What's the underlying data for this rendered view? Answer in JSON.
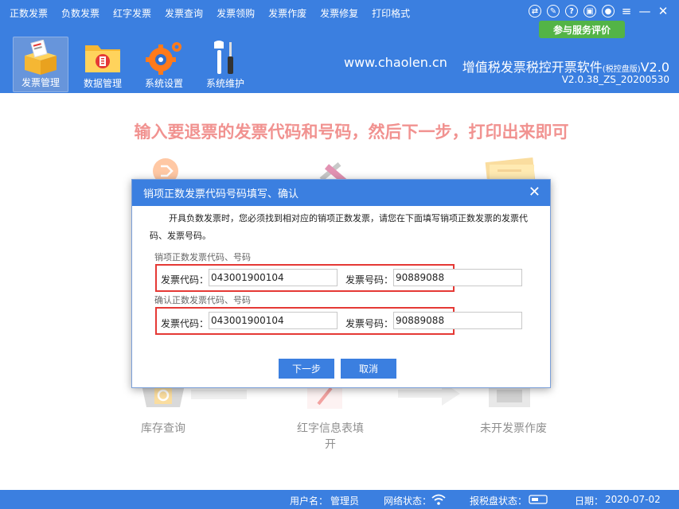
{
  "header": {
    "menu": [
      "正数发票",
      "负数发票",
      "红字发票",
      "发票查询",
      "发票领购",
      "发票作废",
      "发票修复",
      "打印格式"
    ],
    "feedback_button": "参与服务评价",
    "toolbar": {
      "invoice_mgmt": "发票管理",
      "data_mgmt": "数据管理",
      "system_settings": "系统设置",
      "system_maintenance": "系统维护"
    },
    "site_url": "www.chaolen.cn",
    "product_name": "增值税发票税控开票软件",
    "product_edition": "(税控盘版)",
    "product_version_short": "V2.0",
    "product_version": "V2.0.38_ZS_20200530"
  },
  "main": {
    "instruction": "输入要退票的发票代码和号码，然后下一步，打印出来即可",
    "bg_labels": {
      "inventory_query": "库存查询",
      "red_info_form_line1": "红字信息表填",
      "red_info_form_line2": "开",
      "unissued_void": "未开发票作废"
    }
  },
  "dialog": {
    "title": "销项正数发票代码号码填写、确认",
    "description": "开具负数发票时，您必须找到相对应的销项正数发票，请您在下面填写销项正数发票的发票代码、发票号码。",
    "section1_label": "销项正数发票代码、号码",
    "section2_label": "确认正数发票代码、号码",
    "code_label": "发票代码：",
    "number_label": "发票号码：",
    "code_value": "043001900104",
    "number_value": "90889088",
    "confirm_code_value": "043001900104",
    "confirm_number_value": "90889088",
    "next_button": "下一步",
    "cancel_button": "取消"
  },
  "status_bar": {
    "user_label": "用户名：",
    "user_value": "管理员",
    "network_label": "网络状态：",
    "tax_disk_label": "报税盘状态：",
    "date_label": "日期：",
    "date_value": "2020-07-02"
  },
  "colors": {
    "brand_blue": "#3b7fe0",
    "accent_red": "#e53935",
    "feedback_green": "#53b446"
  }
}
